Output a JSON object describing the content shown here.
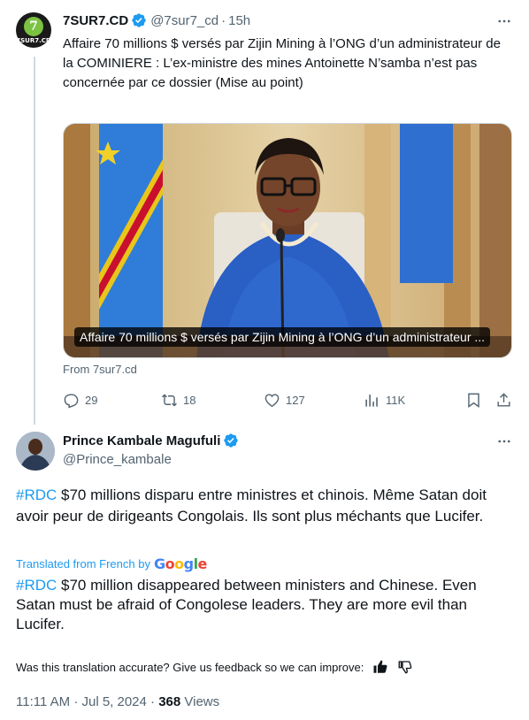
{
  "parent_tweet": {
    "avatar_text": "7SUR7.CD",
    "avatar_glyph": "7",
    "author_name": "7SUR7.CD",
    "handle": "@7sur7_cd",
    "separator": "·",
    "time": "15h",
    "text": "Affaire 70 millions $ versés par Zijin Mining à l’ONG d’un administrateur de la COMINIERE : L’ex-ministre des mines Antoinette N’samba n’est pas concernée par ce dossier (Mise au point)",
    "media_caption": "Affaire 70 millions $ versés par Zijin Mining à l’ONG d’un administrateur ...",
    "media_source": "From 7sur7.cd",
    "counts": {
      "replies": "29",
      "retweets": "18",
      "likes": "127",
      "views": "11K"
    }
  },
  "main_tweet": {
    "author_name": "Prince Kambale Magufuli",
    "handle": "@Prince_kambale",
    "hashtag": "#RDC",
    "original_text_rest": " $70 millions disparu entre ministres et chinois. Même Satan doit avoir peur de dirigeants Congolais.  Ils sont plus méchants que Lucifer.",
    "translated_label": "Translated from French by",
    "google_letters": [
      "G",
      "o",
      "o",
      "g",
      "l",
      "e"
    ],
    "translated_text_rest": " $70 million disappeared between ministers and Chinese. Even Satan must be afraid of Congolese leaders. They are more evil than Lucifer.",
    "feedback_prompt": "Was this translation accurate? Give us feedback so we can improve:",
    "timestamp": "11:11 AM · Jul 5, 2024 · ",
    "views_count": "368",
    "views_label": " Views"
  },
  "colors": {
    "accent": "#1d9bf0",
    "secondary_text": "#536471",
    "primary_text": "#0f1419",
    "border": "#cfd9de"
  },
  "icons": [
    "verified-badge-icon",
    "more-icon",
    "reply-icon",
    "retweet-icon",
    "like-icon",
    "views-icon",
    "bookmark-icon",
    "share-icon",
    "thumbs-up-icon",
    "thumbs-down-icon"
  ]
}
